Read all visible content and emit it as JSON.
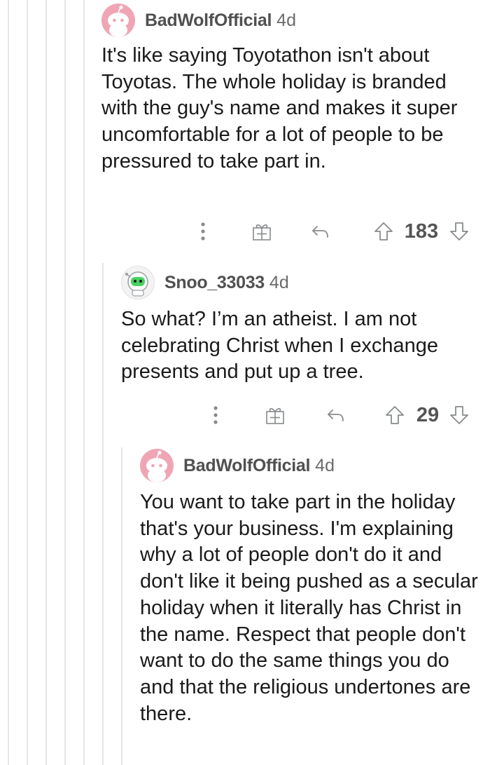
{
  "comments": [
    {
      "username": "BadWolfOfficial",
      "age": "4d",
      "body": "It's like saying Toyotathon isn't about Toyotas. The whole holiday is branded with the guy's name and makes it super uncomfortable for a lot of people to be pressured to take part in.",
      "score": "183",
      "avatar_icon": "snoo-avatar-icon",
      "avatar_color": "#f0a5b4"
    },
    {
      "username": "Snoo_33033",
      "age": "4d",
      "body": "So what? I’m an atheist. I am not celebrating Christ when I exchange presents and put up a tree.",
      "score": "29",
      "avatar_icon": "snoo-astronaut-avatar-icon",
      "avatar_color": "#f3f3f3"
    },
    {
      "username": "BadWolfOfficial",
      "age": "4d",
      "body": "You want to take part in the holiday that's your business. I'm explaining why a lot of people don't do it and don't like it being pushed as a secular holiday when it literally has Christ in the name. Respect that people don't want to do the same things you do and that the religious undertones are there.",
      "avatar_icon": "snoo-avatar-icon",
      "avatar_color": "#f0a5b4"
    }
  ],
  "action_icons": [
    "more-options-icon",
    "award-icon",
    "reply-icon",
    "upvote-icon",
    "downvote-icon"
  ]
}
